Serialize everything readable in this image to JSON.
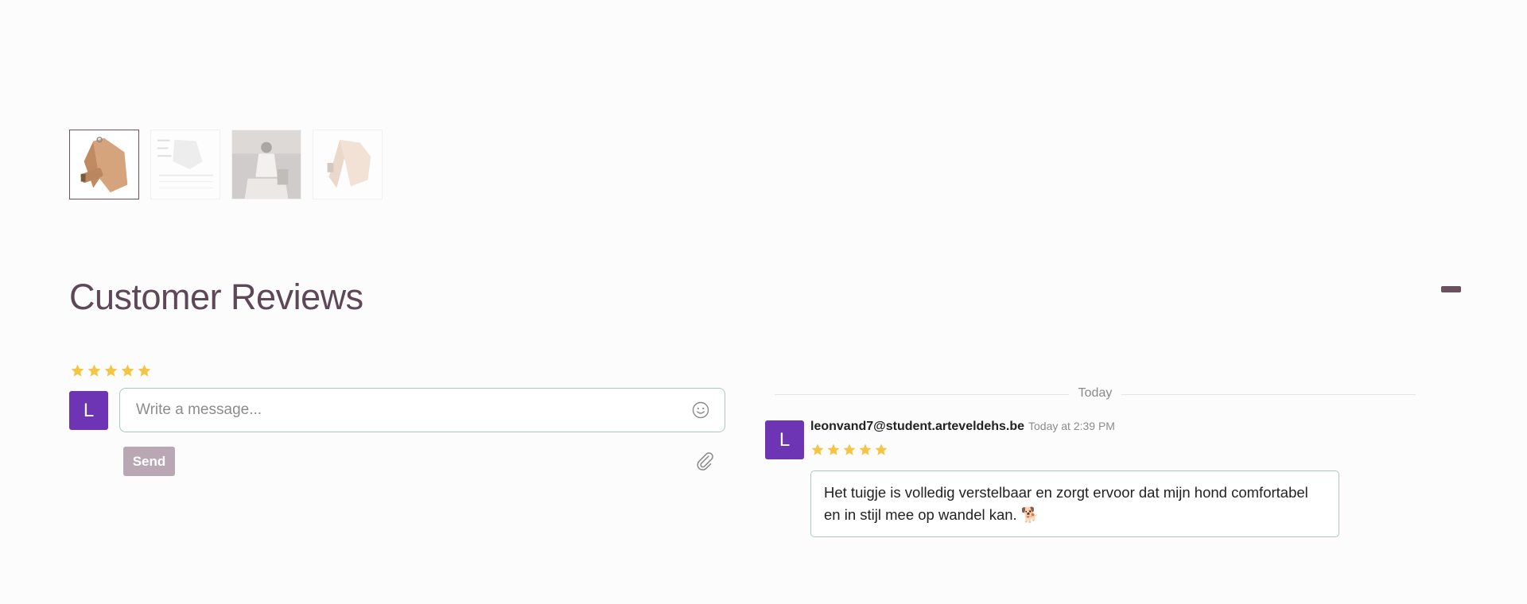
{
  "gallery": {
    "thumbnails": [
      {
        "alt": "harness-front",
        "active": true
      },
      {
        "alt": "size-chart",
        "active": false
      },
      {
        "alt": "model-photo",
        "active": false
      },
      {
        "alt": "harness-side",
        "active": false
      }
    ]
  },
  "reviews": {
    "title": "Customer Reviews",
    "composer": {
      "rating": 5,
      "avatar_initial": "L",
      "placeholder": "Write a message...",
      "send_label": "Send"
    },
    "thread": {
      "date_divider": "Today",
      "messages": [
        {
          "avatar_initial": "L",
          "author": "leonvand7@student.arteveldehs.be",
          "time": "Today at 2:39 PM",
          "rating": 5,
          "text": "Het tuigje is volledig verstelbaar en zorgt ervoor dat mijn hond comfortabel en in stijl mee op wandel kan. 🐕"
        }
      ]
    }
  },
  "colors": {
    "title": "#5e4757",
    "avatar": "#6d34b3",
    "star": "#f4c542",
    "send_disabled": "#b9a8b3",
    "input_border": "#a9c9c3"
  }
}
